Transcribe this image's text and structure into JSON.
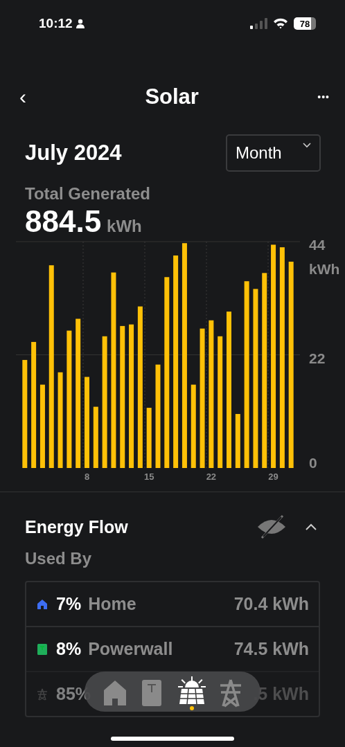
{
  "status_bar": {
    "time": "10:12",
    "battery": "78"
  },
  "nav": {
    "back": "‹",
    "title": "Solar",
    "more": "•••"
  },
  "period": {
    "label": "July 2024",
    "selector": "Month"
  },
  "total": {
    "label": "Total Generated",
    "value": "884.5",
    "unit": "kWh"
  },
  "chart_data": {
    "type": "bar",
    "ylabel": "kWh",
    "x": [
      1,
      2,
      3,
      4,
      5,
      6,
      7,
      8,
      9,
      10,
      11,
      12,
      13,
      14,
      15,
      16,
      17,
      18,
      19,
      20,
      21,
      22,
      23,
      24,
      25,
      26,
      27,
      28,
      29,
      30,
      31
    ],
    "series": [
      {
        "color": "#ffc107",
        "values": [
          21.0,
          24.5,
          16.2,
          39.4,
          18.6,
          26.7,
          29.0,
          17.7,
          11.9,
          25.6,
          38.0,
          27.6,
          27.9,
          31.4,
          11.7,
          20.1,
          37.1,
          41.3,
          43.7,
          16.2,
          27.1,
          28.7,
          25.6,
          30.4,
          10.5,
          36.3,
          34.8,
          37.9,
          43.4,
          42.9,
          40.1
        ]
      }
    ],
    "xlim": [
      0,
      32
    ],
    "ylim": [
      0,
      44
    ],
    "yticks": [
      0,
      22,
      44
    ],
    "xticks": [
      8,
      15,
      22,
      29
    ]
  },
  "energy_flow": {
    "title": "Energy Flow",
    "expanded": true,
    "subtitle": "Used By",
    "rows": [
      {
        "kind": "home",
        "percent": "7%",
        "label": "Home",
        "value": "70.4 kWh"
      },
      {
        "kind": "powerwall",
        "percent": "8%",
        "label": "Powerwall",
        "value": "74.5 kWh"
      },
      {
        "kind": "grid",
        "percent": "85%",
        "value": ".5 kWh"
      }
    ]
  },
  "tab_bar": [
    {
      "kind": "home",
      "selected": false
    },
    {
      "kind": "powerwall",
      "selected": false
    },
    {
      "kind": "solar",
      "selected": true
    },
    {
      "kind": "grid",
      "selected": false
    }
  ]
}
